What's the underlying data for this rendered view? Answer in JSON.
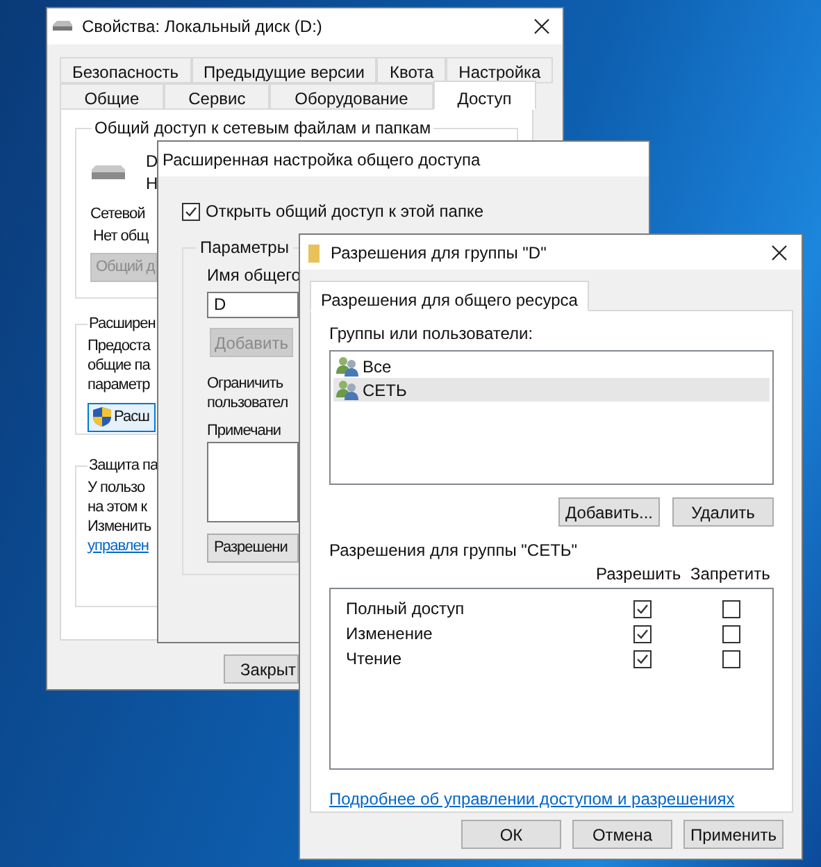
{
  "properties_window": {
    "title": "Свойства: Локальный диск (D:)",
    "tabs_row_1": [
      {
        "label": "Безопасность",
        "selected": false
      },
      {
        "label": "Предыдущие версии",
        "selected": false
      },
      {
        "label": "Квота",
        "selected": false
      },
      {
        "label": "Настройка",
        "selected": false
      }
    ],
    "tabs_row_2": [
      {
        "label": "Общие",
        "selected": false
      },
      {
        "label": "Сервис",
        "selected": false
      },
      {
        "label": "Оборудование",
        "selected": false
      },
      {
        "label": "Доступ",
        "selected": true
      }
    ],
    "network_sharing": {
      "title": "Общий доступ к сетевым файлам и папкам",
      "drive_lines": [
        "D",
        "Н"
      ],
      "path_label": "Сетевой",
      "status": "Нет общ",
      "button": {
        "label": "Общий д",
        "disabled": true
      }
    },
    "advanced_sharing": {
      "title": "Расширен",
      "lines": [
        "Предоста",
        "общие па",
        "параметр"
      ],
      "button": {
        "label": "Расш",
        "disabled": false
      }
    },
    "password_protection": {
      "title": "Защита па",
      "lines": [
        "У пользо",
        "на этом к",
        "Изменить"
      ],
      "link": "управлен"
    },
    "close_button": "Закрыт"
  },
  "advanced_window": {
    "title": "Расширенная настройка общего доступа",
    "share_checkbox": {
      "label": "Открыть общий доступ к этой папке",
      "checked": true
    },
    "parameters": {
      "title": "Параметры",
      "share_name_label": "Имя общего",
      "share_name_value": "D",
      "add_button": {
        "label": "Добавить",
        "disabled": true
      },
      "limit_lines": [
        "Ограничить",
        "пользовател"
      ],
      "comment_label": "Примечани",
      "permissions_button": "Разрешени"
    }
  },
  "permissions_window": {
    "title": "Разрешения для группы \"D\"",
    "tabs": [
      {
        "label": "Разрешения для общего ресурса",
        "selected": true
      }
    ],
    "groups_label": "Группы или пользователи:",
    "groups": [
      {
        "name": "Все",
        "selected": false
      },
      {
        "name": "СЕТЬ",
        "selected": true
      }
    ],
    "add_button": "Добавить...",
    "remove_button": "Удалить",
    "permissions_label": "Разрешения для группы \"СЕТЬ\"",
    "allow_header": "Разрешить",
    "deny_header": "Запретить",
    "permissions": [
      {
        "name": "Полный доступ",
        "allow": true,
        "deny": false
      },
      {
        "name": "Изменение",
        "allow": true,
        "deny": false
      },
      {
        "name": "Чтение",
        "allow": true,
        "deny": false
      }
    ],
    "link": "Подробнее об управлении доступом и разрешениях",
    "buttons": [
      "ОК",
      "Отмена",
      "Применить"
    ]
  }
}
